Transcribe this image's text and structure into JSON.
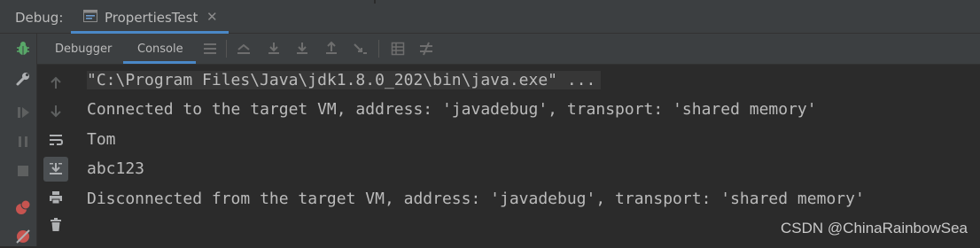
{
  "topbar": {
    "label": "Debug:",
    "run_tab": {
      "title": "PropertiesTest",
      "close": "✕",
      "icon": "application-config-icon"
    }
  },
  "subbar": {
    "tabs": [
      {
        "label": "Debugger",
        "active": false
      },
      {
        "label": "Console",
        "active": true
      }
    ],
    "toolbar_icons": [
      "menu-icon",
      "show-execution-point-icon",
      "step-over-icon",
      "step-into-icon",
      "step-out-icon",
      "run-to-cursor-icon",
      "evaluate-expression-icon",
      "trace-icon"
    ]
  },
  "left_toolbar_icons": [
    "bug-icon",
    "wrench-icon",
    "resume-icon",
    "pause-icon",
    "stop-icon",
    "breakpoints-icon",
    "mute-breakpoints-icon"
  ],
  "console_gutter_icons": [
    "up-arrow-icon",
    "down-arrow-icon",
    "soft-wrap-icon",
    "scroll-to-end-icon",
    "print-icon",
    "trash-icon"
  ],
  "console": {
    "lines": [
      "\"C:\\Program Files\\Java\\jdk1.8.0_202\\bin\\java.exe\" ...",
      "Connected to the target VM, address: 'javadebug', transport: 'shared memory'",
      "Tom",
      "abc123",
      "Disconnected from the target VM, address: 'javadebug', transport: 'shared memory'"
    ]
  },
  "watermark": "CSDN @ChinaRainbowSea",
  "colors": {
    "accent": "#4a88c7",
    "bug": "#59a869",
    "stop": "#c75450",
    "panel": "#3c3f41",
    "editor": "#2b2b2b",
    "text": "#bbbbbb"
  }
}
